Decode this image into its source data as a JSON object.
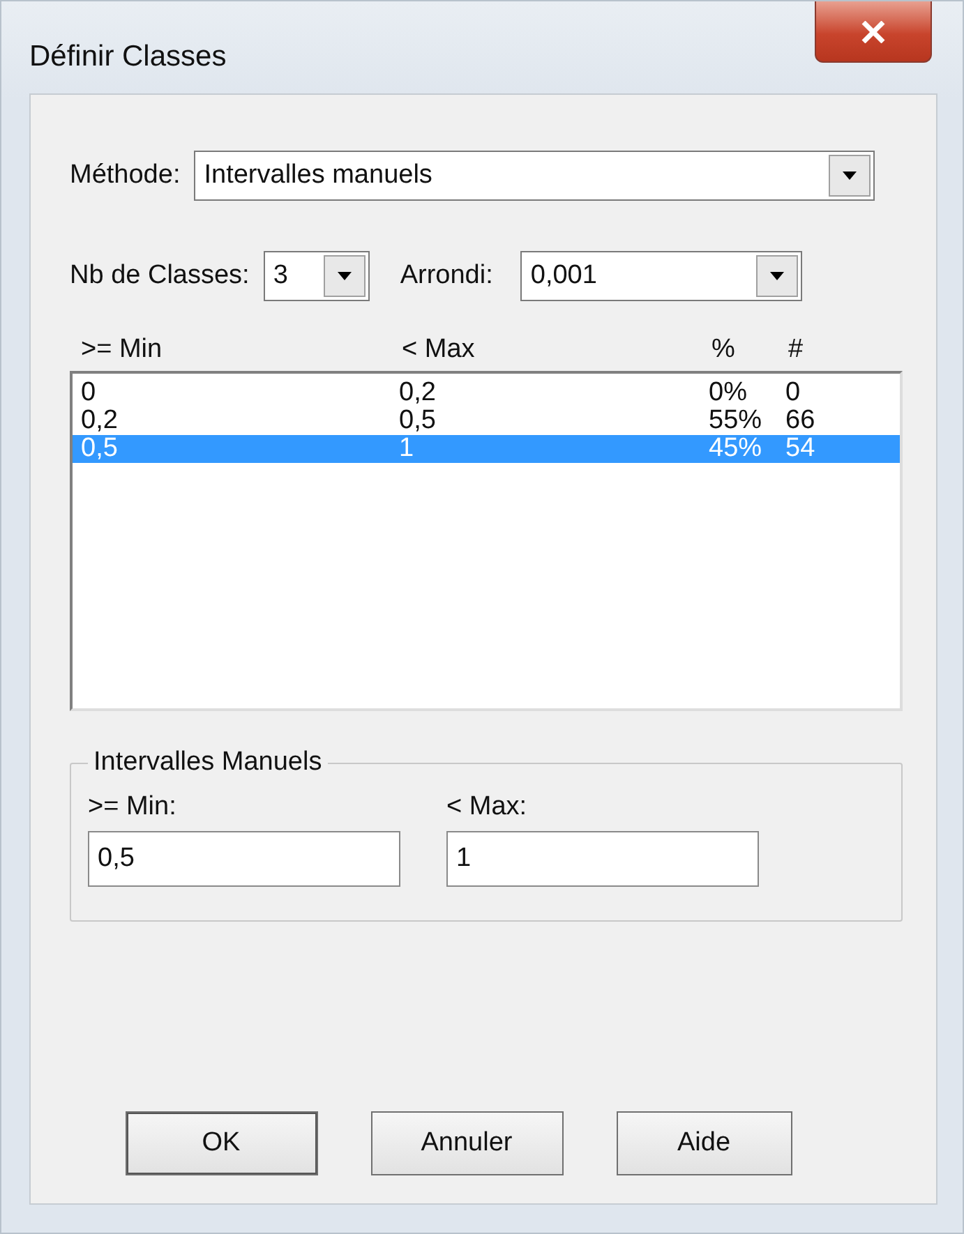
{
  "window": {
    "title": "Définir Classes"
  },
  "method": {
    "label": "Méthode:",
    "value": "Intervalles manuels"
  },
  "class_count": {
    "label": "Nb de Classes:",
    "value": "3"
  },
  "rounding": {
    "label": "Arrondi:",
    "value": "0,001"
  },
  "table": {
    "columns": [
      ">= Min",
      "< Max",
      "%",
      "#"
    ],
    "rows": [
      {
        "cells": [
          "0",
          "0,2",
          "0%",
          "0"
        ],
        "selected": false
      },
      {
        "cells": [
          "0,2",
          "0,5",
          "55%",
          "66"
        ],
        "selected": false
      },
      {
        "cells": [
          "0,5",
          "1",
          "45%",
          "54"
        ],
        "selected": true
      }
    ]
  },
  "manual_intervals": {
    "title": "Intervalles Manuels",
    "min_label": ">= Min:",
    "min_value": "0,5",
    "max_label": "< Max:",
    "max_value": "1"
  },
  "buttons": [
    "OK",
    "Annuler",
    "Aide"
  ]
}
